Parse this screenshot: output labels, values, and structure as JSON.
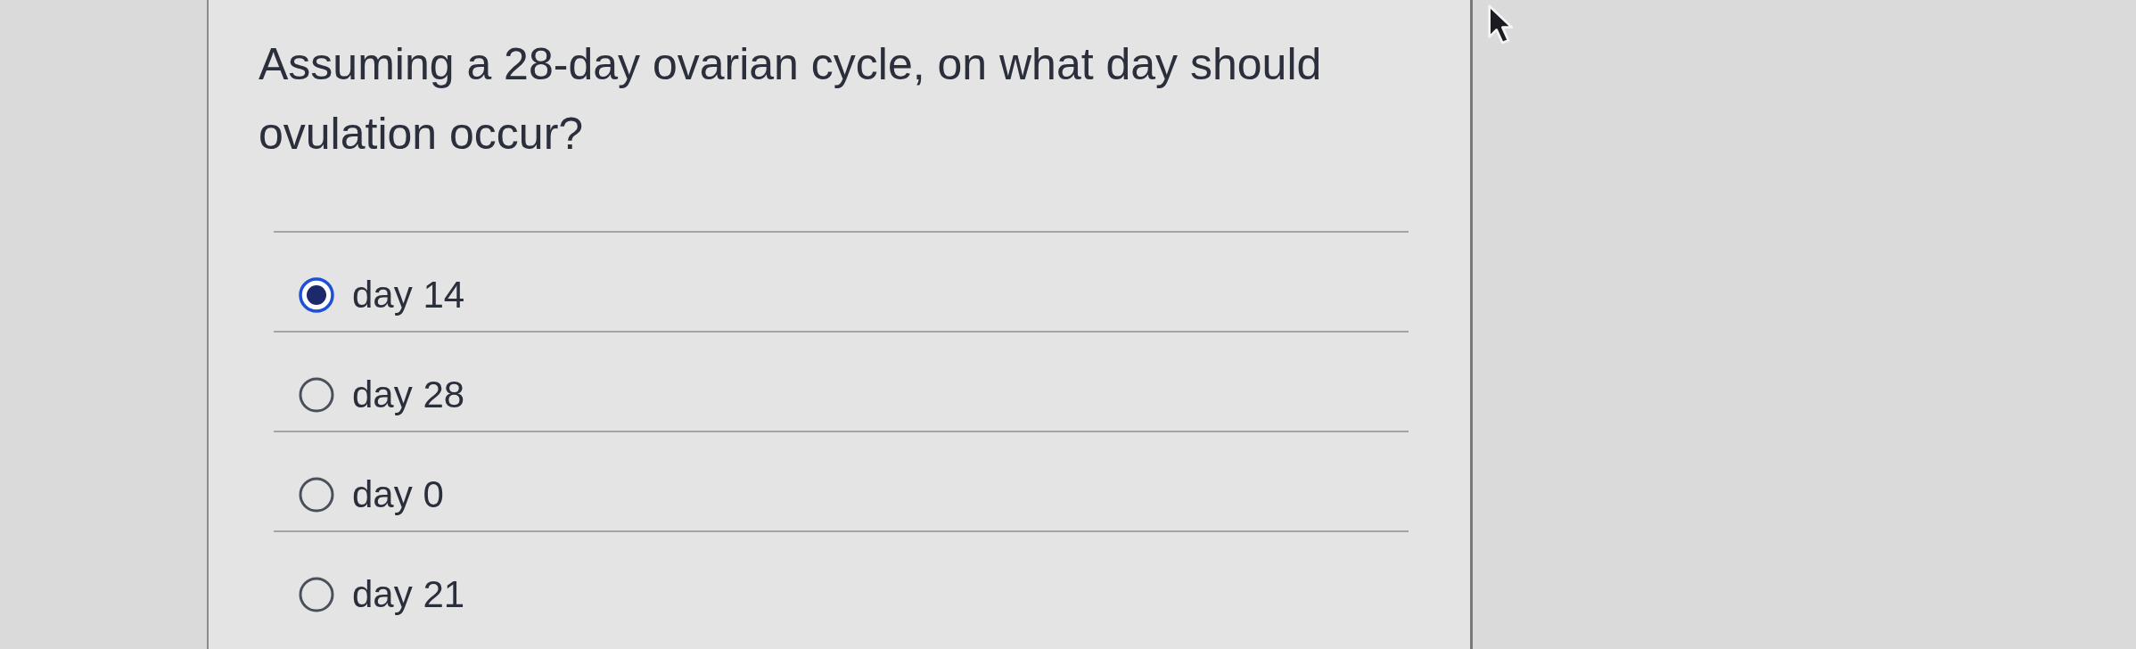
{
  "question": {
    "text": "Assuming a 28-day ovarian cycle, on what day should ovulation occur?"
  },
  "options": [
    {
      "label": "day 14",
      "selected": true
    },
    {
      "label": "day 28",
      "selected": false
    },
    {
      "label": "day 0",
      "selected": false
    },
    {
      "label": "day 21",
      "selected": false
    }
  ]
}
